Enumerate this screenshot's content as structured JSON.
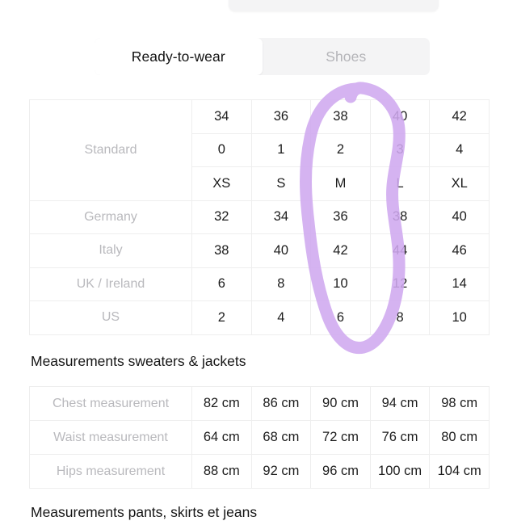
{
  "tabs": [
    {
      "label": "Ready-to-wear",
      "active": true
    },
    {
      "label": "Shoes",
      "active": false
    }
  ],
  "conversion_table": {
    "rows": [
      {
        "label": "Standard",
        "label_rowspan": 3,
        "values": [
          "34",
          "36",
          "38",
          "40",
          "42"
        ]
      },
      {
        "label": "",
        "label_rowspan": 0,
        "values": [
          "0",
          "1",
          "2",
          "3",
          "4"
        ]
      },
      {
        "label": "",
        "label_rowspan": 0,
        "values": [
          "XS",
          "S",
          "M",
          "L",
          "XL"
        ]
      },
      {
        "label": "Germany",
        "label_rowspan": 1,
        "values": [
          "32",
          "34",
          "36",
          "38",
          "40"
        ]
      },
      {
        "label": "Italy",
        "label_rowspan": 1,
        "values": [
          "38",
          "40",
          "42",
          "44",
          "46"
        ]
      },
      {
        "label": "UK / Ireland",
        "label_rowspan": 1,
        "values": [
          "6",
          "8",
          "10",
          "12",
          "14"
        ]
      },
      {
        "label": "US",
        "label_rowspan": 1,
        "values": [
          "2",
          "4",
          "6",
          "8",
          "10"
        ]
      }
    ]
  },
  "headings": {
    "sweaters": "Measurements sweaters & jackets",
    "pants": "Measurements pants, skirts et jeans"
  },
  "measure_table": {
    "rows": [
      {
        "label": "Chest measurement",
        "values": [
          "82 cm",
          "86 cm",
          "90 cm",
          "94 cm",
          "98 cm"
        ]
      },
      {
        "label": "Waist measurement",
        "values": [
          "64 cm",
          "68 cm",
          "72 cm",
          "76 cm",
          "80 cm"
        ]
      },
      {
        "label": "Hips measurement",
        "values": [
          "88 cm",
          "92 cm",
          "96 cm",
          "100 cm",
          "104 cm"
        ]
      }
    ]
  },
  "annotation": {
    "shape": "hand-drawn-oval",
    "color": "#cfa9ef",
    "highlights_column_labels": [
      "38",
      "2",
      "M",
      "36",
      "42",
      "10",
      "6"
    ]
  },
  "colors": {
    "background": "#ffffff",
    "tab_track": "#f4f4f5",
    "tab_active": "#ffffff",
    "tab_inactive_text": "#b4b4b8",
    "table_border": "#eeeeee",
    "row_label_text": "#b9b9bd",
    "cell_text": "#1c1c1c",
    "annotation_purple": "#cfa9ef"
  }
}
